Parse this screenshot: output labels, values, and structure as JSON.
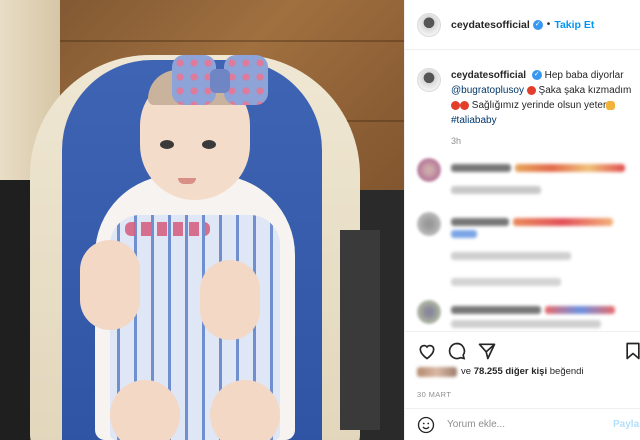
{
  "post": {
    "username": "ceydatesofficial",
    "follow_label": "Takip Et",
    "separator": "•"
  },
  "caption": {
    "username": "ceydatesofficial",
    "part1": "Hep baba diyorlar",
    "mention": "@bugratoplusoy",
    "part2": "Şaka şaka kızmadım",
    "part3": "Sağlığımız yerinde olsun yeter",
    "hashtag": "#taliababy",
    "time": "3h"
  },
  "likes": {
    "prefix": "ve",
    "count": "78.255 diğer kişi",
    "suffix": "beğendi"
  },
  "date": "30 MART",
  "composer": {
    "placeholder": "Yorum ekle...",
    "post_label": "Paylaş"
  },
  "colors": {
    "link": "#00376b",
    "follow": "#0095f6",
    "verified": "#3897f0"
  },
  "icons": [
    "heart-icon",
    "comment-icon",
    "share-icon",
    "bookmark-icon",
    "smile-icon",
    "verified-icon"
  ]
}
